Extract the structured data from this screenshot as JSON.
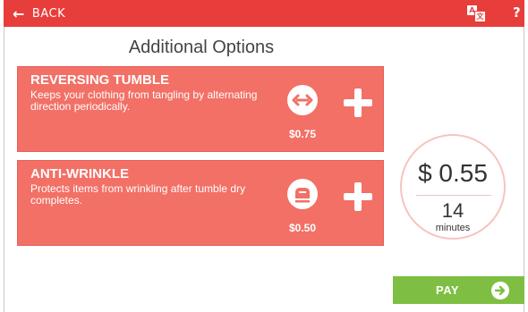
{
  "header": {
    "back_label": "BACK",
    "back_icon": "left-arrow-icon",
    "language_icon": "translate-icon",
    "help_label": "?"
  },
  "page": {
    "title": "Additional Options"
  },
  "options": [
    {
      "title": "REVERSING TUMBLE",
      "description": "Keeps your clothing from tangling by alternating direction periodically.",
      "price": "$0.75",
      "icon": "reverse-arrows-icon",
      "add_icon": "plus-icon"
    },
    {
      "title": "ANTI-WRINKLE",
      "description": "Protects items from wrinkling after tumble dry completes.",
      "price": "$0.50",
      "icon": "iron-icon",
      "add_icon": "plus-icon"
    }
  ],
  "summary": {
    "total": "$ 0.55",
    "minutes": "14",
    "minutes_label": "minutes"
  },
  "pay": {
    "label": "PAY",
    "icon": "arrow-right-circle-icon"
  },
  "colors": {
    "header": "#e83e3b",
    "card": "#f27066",
    "pay": "#7ebf43",
    "summary_ring": "#f6c4bf"
  }
}
